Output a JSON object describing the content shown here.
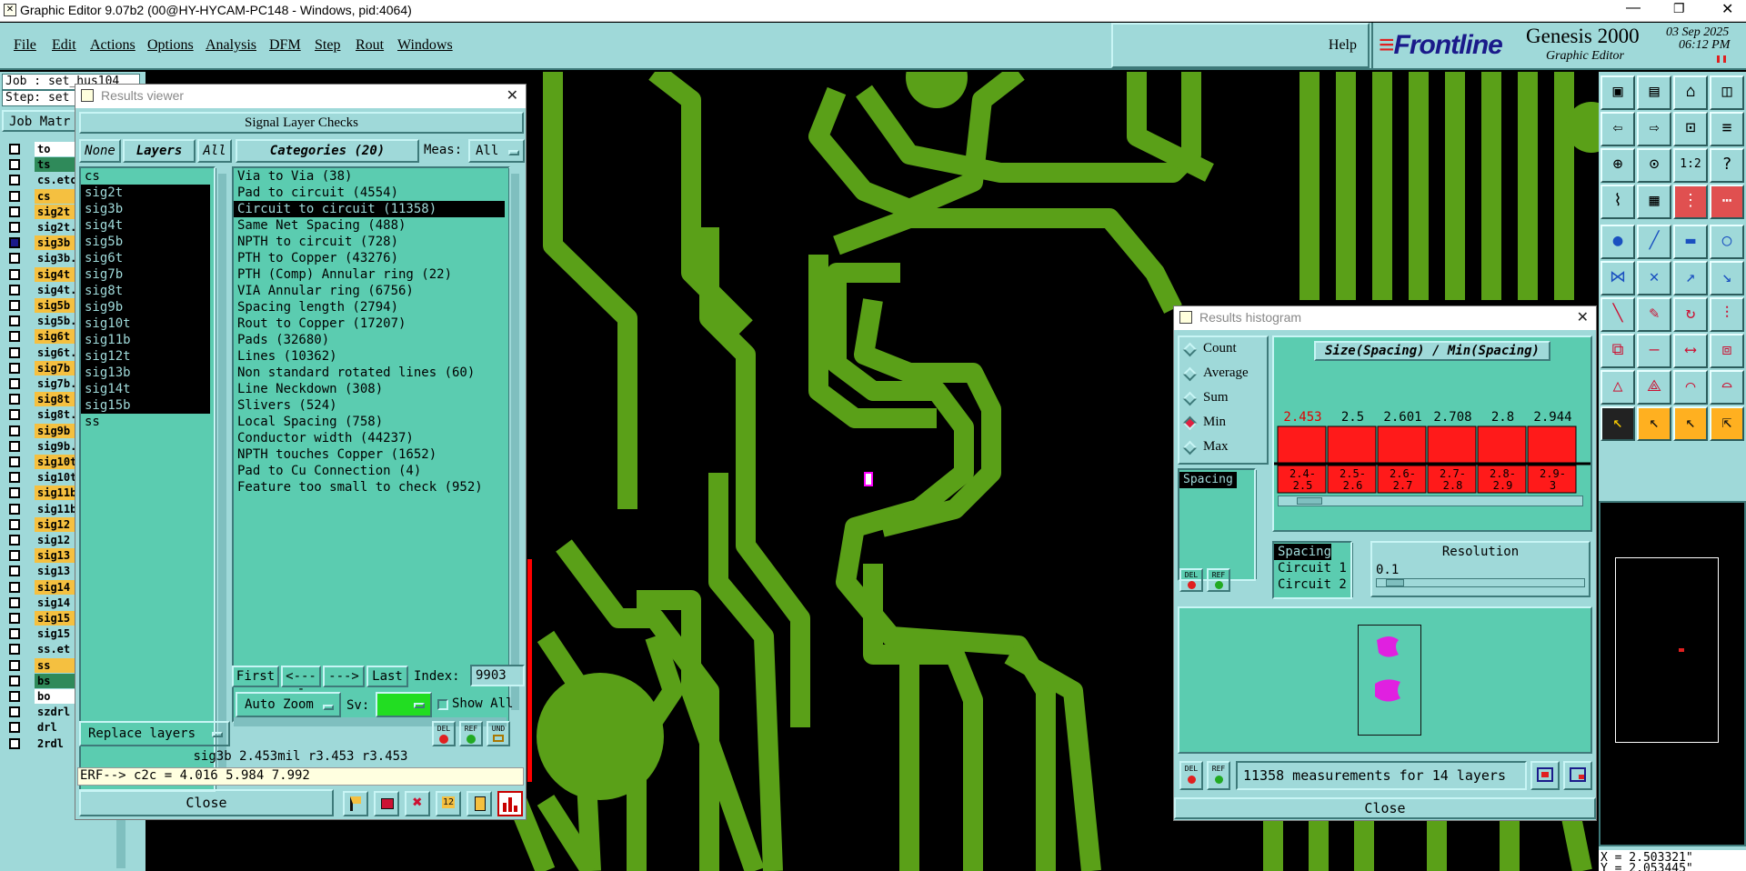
{
  "window": {
    "title": "Graphic Editor 9.07b2 (00@HY-HYCAM-PC148 - Windows, pid:4064)"
  },
  "menubar": {
    "items": [
      "File",
      "Edit",
      "Actions",
      "Options",
      "Analysis",
      "DFM",
      "Step",
      "Rout",
      "Windows"
    ],
    "help": "Help"
  },
  "brand": {
    "logo": "Frontline",
    "product": "Genesis 2000",
    "subtitle": "Graphic Editor",
    "date": "03 Sep 2025",
    "time": "06:12 PM"
  },
  "job_panel": {
    "job_label": "Job : set_hus104",
    "step_label": "Step: set",
    "job_matrix": "Job Matr",
    "layers": [
      {
        "name": "to",
        "color": "#ffffff"
      },
      {
        "name": "ts",
        "color": "#2f8a5a"
      },
      {
        "name": "cs.etc",
        "color": "#9fd9d9"
      },
      {
        "name": "cs",
        "color": "#f5c040"
      },
      {
        "name": "sig2t",
        "color": "#f5c040"
      },
      {
        "name": "sig2t.",
        "color": "#9fd9d9"
      },
      {
        "name": "sig3b",
        "color": "#f5c040"
      },
      {
        "name": "sig3b.",
        "color": "#9fd9d9"
      },
      {
        "name": "sig4t",
        "color": "#f5c040"
      },
      {
        "name": "sig4t.",
        "color": "#9fd9d9"
      },
      {
        "name": "sig5b",
        "color": "#f5c040"
      },
      {
        "name": "sig5b.",
        "color": "#9fd9d9"
      },
      {
        "name": "sig6t",
        "color": "#f5c040"
      },
      {
        "name": "sig6t.",
        "color": "#9fd9d9"
      },
      {
        "name": "sig7b",
        "color": "#f5c040"
      },
      {
        "name": "sig7b.",
        "color": "#9fd9d9"
      },
      {
        "name": "sig8t",
        "color": "#f5c040"
      },
      {
        "name": "sig8t.",
        "color": "#9fd9d9"
      },
      {
        "name": "sig9b",
        "color": "#f5c040"
      },
      {
        "name": "sig9b.",
        "color": "#9fd9d9"
      },
      {
        "name": "sig10t",
        "color": "#f5c040"
      },
      {
        "name": "sig10t",
        "color": "#9fd9d9"
      },
      {
        "name": "sig11b",
        "color": "#f5c040"
      },
      {
        "name": "sig11b",
        "color": "#9fd9d9"
      },
      {
        "name": "sig12",
        "color": "#f5c040"
      },
      {
        "name": "sig12",
        "color": "#9fd9d9"
      },
      {
        "name": "sig13",
        "color": "#f5c040"
      },
      {
        "name": "sig13",
        "color": "#9fd9d9"
      },
      {
        "name": "sig14",
        "color": "#f5c040"
      },
      {
        "name": "sig14",
        "color": "#9fd9d9"
      },
      {
        "name": "sig15",
        "color": "#f5c040"
      },
      {
        "name": "sig15",
        "color": "#9fd9d9"
      },
      {
        "name": "ss.et",
        "color": "#9fd9d9"
      },
      {
        "name": "ss",
        "color": "#f5c040"
      },
      {
        "name": "bs",
        "color": "#2f8a5a"
      },
      {
        "name": "bo",
        "color": "#ffffff"
      },
      {
        "name": "szdrl",
        "color": "#9fd9d9"
      },
      {
        "name": "drl",
        "color": "#9fd9d9"
      },
      {
        "name": "2rdl",
        "color": "#9fd9d9"
      }
    ]
  },
  "results_viewer": {
    "title": "Results viewer",
    "header": "Signal Layer Checks",
    "none_btn": "None",
    "layers_btn": "Layers",
    "all_btn": "All",
    "categories_btn": "Categories (20)",
    "meas_label": "Meas:",
    "meas_value": "All",
    "layer_list": [
      "cs",
      "sig2t",
      "sig3b",
      "sig4t",
      "sig5b",
      "sig6t",
      "sig7b",
      "sig8t",
      "sig9b",
      "sig10t",
      "sig11b",
      "sig12t",
      "sig13b",
      "sig14t",
      "sig15b",
      "ss"
    ],
    "categories": [
      "Via to Via (38)",
      "Pad to circuit (4554)",
      "Circuit to circuit (11358)",
      "Same Net Spacing (488)",
      "NPTH to circuit (728)",
      "PTH to Copper (43276)",
      "PTH (Comp) Annular ring (22)",
      "VIA Annular ring (6756)",
      "Spacing length (2794)",
      "Rout to Copper (17207)",
      "Pads (32680)",
      "Lines (10362)",
      "Non standard rotated lines (60)",
      "Line Neckdown (308)",
      "Slivers (524)",
      "Local Spacing (758)",
      "Conductor width (44237)",
      "NPTH touches Copper (1652)",
      "Pad to Cu Connection (4)",
      "Feature too small to check (952)"
    ],
    "first_btn": "First",
    "prev_btn": "<----",
    "next_btn": "--->",
    "last_btn": "Last",
    "index_label": "Index:",
    "index_value": "9903",
    "autozoom_btn": "Auto Zoom",
    "sv_label": "Sv:",
    "show_all": "Show All",
    "replace_btn": "Replace layers",
    "status1": "sig3b 2.453mil  r3.453  r3.453",
    "status2": "ERF--> c2c = 4.016 5.984 7.992",
    "close_btn": "Close",
    "del_label": "DEL",
    "ref_label": "REF",
    "und_label": "UND"
  },
  "histogram": {
    "title": "Results histogram",
    "radios": [
      "Count",
      "Average",
      "Sum",
      "Min",
      "Max"
    ],
    "selected_radio": "Min",
    "chart_title": "Size(Spacing) / Min(Spacing)",
    "values": [
      "2.453",
      "2.5",
      "2.601",
      "2.708",
      "2.8",
      "2.944"
    ],
    "ranges_top": [
      "2.4-",
      "2.5-",
      "2.6-",
      "2.7-",
      "2.8-",
      "2.9-"
    ],
    "ranges_bottom": [
      "2.5",
      "2.6",
      "2.7",
      "2.8",
      "2.9",
      "3"
    ],
    "size_list": [
      "Spacing"
    ],
    "param_list": [
      "Spacing",
      "Circuit 1",
      "Circuit 2"
    ],
    "resolution_label": "Resolution",
    "resolution_value": "0.1",
    "summary": "11358 measurements for 14 layers",
    "close_btn": "Close",
    "del_label": "DEL",
    "ref_label": "REF"
  },
  "coords": {
    "x": "X = 2.503321\"",
    "y": "Y = 2.053445\""
  },
  "colors": {
    "copper": "#5aa018",
    "panel": "#9fd9d9",
    "list": "#5bccb0",
    "bar": "#ff1a1a"
  }
}
